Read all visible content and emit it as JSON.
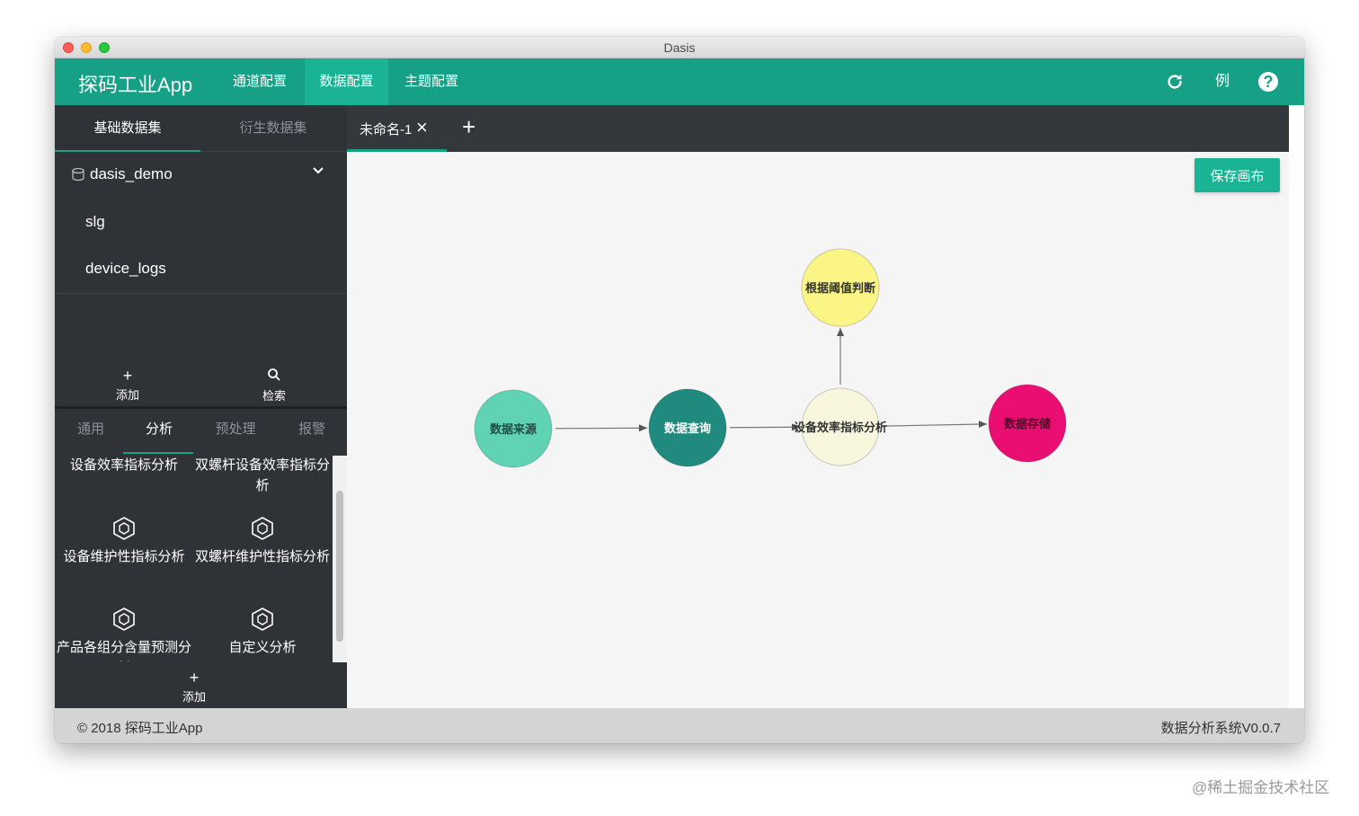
{
  "window": {
    "title": "Dasis"
  },
  "topnav": {
    "brand": "探码工业App",
    "tabs": [
      {
        "label": "通道配置",
        "active": false
      },
      {
        "label": "数据配置",
        "active": true
      },
      {
        "label": "主题配置",
        "active": false
      }
    ],
    "icons": {
      "refresh": "refresh-icon",
      "example_label": "例",
      "help": "?"
    }
  },
  "sidebar": {
    "tabs": [
      {
        "label": "基础数据集",
        "active": true
      },
      {
        "label": "衍生数据集",
        "active": false
      }
    ],
    "database": {
      "name": "dasis_demo",
      "icon": "database-icon",
      "expanded": true
    },
    "tables": [
      "slg",
      "device_logs"
    ],
    "tools": {
      "add_label": "添加",
      "search_label": "检索"
    },
    "component_tabs": [
      {
        "label": "通用",
        "active": false
      },
      {
        "label": "分析",
        "active": true
      },
      {
        "label": "预处理",
        "active": false
      },
      {
        "label": "报警",
        "active": false
      }
    ],
    "components": [
      "设备效率指标分析",
      "双螺杆设备效率指标分析",
      "设备维护性指标分析",
      "双螺杆维护性指标分析",
      "产品各组分含量预测分析",
      "自定义分析"
    ],
    "footer_add_label": "添加"
  },
  "flow_tabs": [
    {
      "label": "未命名-1",
      "close": "×"
    }
  ],
  "add_tab": "+",
  "save_button": "保存画布",
  "canvas": {
    "nodes": [
      {
        "id": "source",
        "label": "数据来源",
        "color": "#5fd3b3",
        "text_color": "#1f4f44"
      },
      {
        "id": "query",
        "label": "数据查询",
        "color": "#208a7e",
        "text_color": "#ffffff"
      },
      {
        "id": "analysis",
        "label": "设备效率指标分析",
        "color": "#f8f6dd",
        "text_color": "#333333"
      },
      {
        "id": "threshold",
        "label": "根据阈值判断",
        "color": "#fbf586",
        "text_color": "#333333"
      },
      {
        "id": "storage",
        "label": "数据存储",
        "color": "#ea0e73",
        "text_color": "#4a0a25"
      }
    ],
    "edges": [
      {
        "from": "source",
        "to": "query"
      },
      {
        "from": "query",
        "to": "analysis"
      },
      {
        "from": "analysis",
        "to": "threshold"
      },
      {
        "from": "analysis",
        "to": "storage"
      }
    ]
  },
  "footer": {
    "copyright": "© 2018 探码工业App",
    "version": "数据分析系统V0.0.7"
  },
  "watermark": "@稀土掘金技术社区",
  "colors": {
    "primary": "#16a085",
    "sidebar": "#2f3338",
    "tabbar": "#34373b"
  }
}
